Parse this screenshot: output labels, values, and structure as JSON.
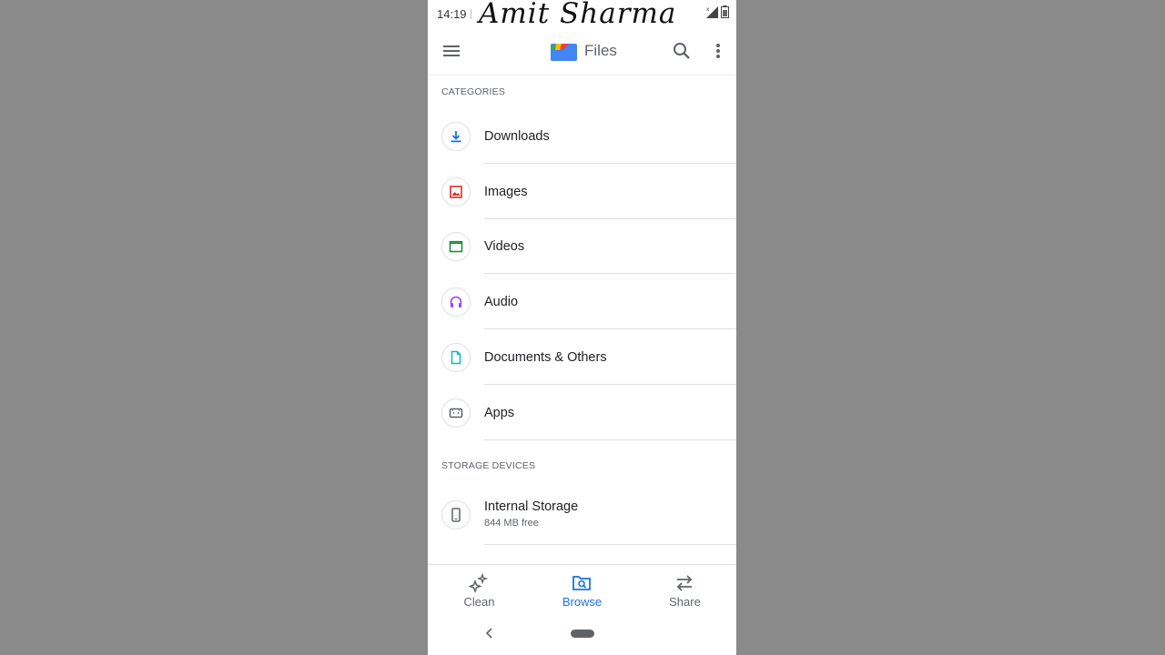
{
  "status_bar": {
    "time": "14:19",
    "watermark": "Amit Sharma"
  },
  "app_bar": {
    "title": "Files"
  },
  "sections": {
    "categories": "CATEGORIES",
    "storage": "STORAGE DEVICES"
  },
  "categories": [
    {
      "label": "Downloads",
      "icon": "download-icon",
      "color": "#1a73e8"
    },
    {
      "label": "Images",
      "icon": "image-icon",
      "color": "#d93025"
    },
    {
      "label": "Videos",
      "icon": "video-icon",
      "color": "#1e8e3e"
    },
    {
      "label": "Audio",
      "icon": "headphones-icon",
      "color": "#a142f4"
    },
    {
      "label": "Documents & Others",
      "icon": "document-icon",
      "color": "#12b5cb"
    },
    {
      "label": "Apps",
      "icon": "android-icon",
      "color": "#5f6368"
    }
  ],
  "storage": [
    {
      "label": "Internal Storage",
      "detail": "844 MB free",
      "icon": "phone-icon"
    }
  ],
  "bottom_nav": [
    {
      "label": "Clean",
      "icon": "sparkle-icon",
      "active": false
    },
    {
      "label": "Browse",
      "icon": "browse-folder-icon",
      "active": true
    },
    {
      "label": "Share",
      "icon": "swap-arrows-icon",
      "active": false
    }
  ],
  "colors": {
    "accent": "#1a73e8",
    "text": "#202124",
    "secondary": "#5f6368"
  }
}
